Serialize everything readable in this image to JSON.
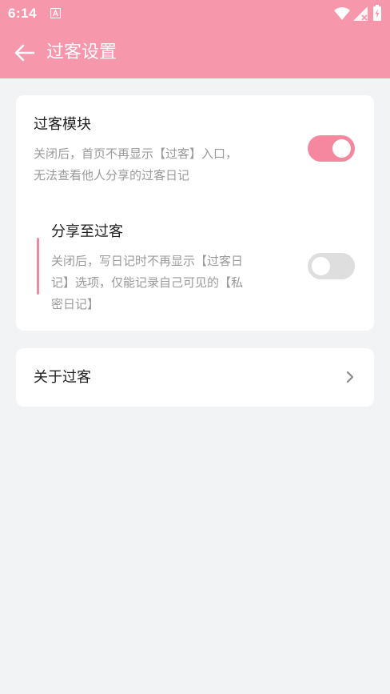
{
  "status_bar": {
    "time": "6:14"
  },
  "header": {
    "title": "过客设置"
  },
  "settings": {
    "guest_module": {
      "title": "过客模块",
      "description_line1": "关闭后，首页不再显示【过客】入口，",
      "description_line2": "无法查看他人分享的过客日记",
      "enabled": true
    },
    "share_to_guest": {
      "title": "分享至过客",
      "description_line1": "关闭后，写日记时不再显示【过客日",
      "description_line2": "记】选项，仅能记录自己可见的【私",
      "description_line3": "密日记】",
      "enabled": false
    }
  },
  "about": {
    "label": "关于过客"
  },
  "colors": {
    "accent": "#f797ab",
    "toggle_on": "#f5889f",
    "toggle_off": "#dedede",
    "background": "#f2f3f5"
  }
}
